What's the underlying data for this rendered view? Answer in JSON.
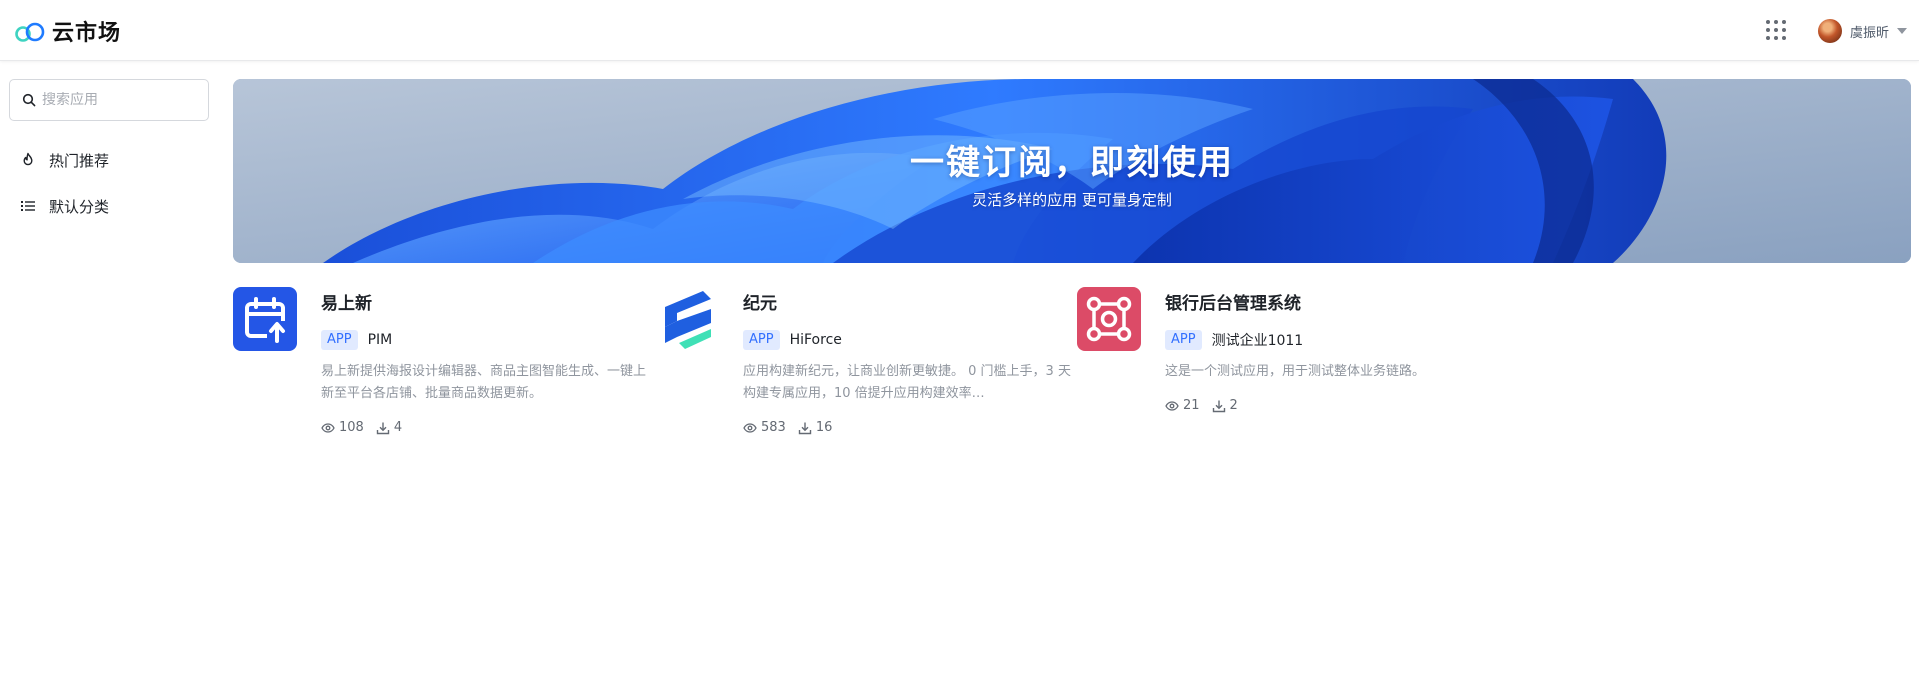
{
  "app": {
    "logo_text": "云市场",
    "logo_icon": "cloud-logo-icon"
  },
  "header": {
    "apps_icon": "grid-icon",
    "user_name": "虞振昕",
    "dropdown_icon": "chevron-down-icon"
  },
  "sidebar": {
    "search": {
      "placeholder": "搜索应用",
      "value": ""
    },
    "items": [
      {
        "label": "热门推荐",
        "icon": "flame-icon"
      },
      {
        "label": "默认分类",
        "icon": "list-icon"
      }
    ]
  },
  "banner": {
    "title": "一键订阅，即刻使用",
    "subtitle": "灵活多样的应用 更可量身定制"
  },
  "apps": [
    {
      "title": "易上新",
      "tag": "APP",
      "vendor": "PIM",
      "description": "易上新提供海报设计编辑器、商品主图智能生成、一键上新至平台各店铺、批量商品数据更新。",
      "views": "108",
      "downloads": "4",
      "icon": "calendar-upload-icon",
      "icon_color": "#2456e6"
    },
    {
      "title": "纪元",
      "tag": "APP",
      "vendor": "HiForce",
      "description": "应用构建新纪元，让商业创新更敏捷。 0 门槛上手，3 天构建专属应用，10 倍提升应用构建效率…",
      "views": "583",
      "downloads": "16",
      "icon": "hiforce-logo-icon",
      "icon_color": "#1f5fe0"
    },
    {
      "title": "银行后台管理系统",
      "tag": "APP",
      "vendor": "测试企业1011",
      "description": "这是一个测试应用，用于测试整体业务链路。",
      "views": "21",
      "downloads": "2",
      "icon": "nodes-square-icon",
      "icon_color": "#dc4b67"
    }
  ],
  "colors": {
    "accent": "#3370ff",
    "tag_bg": "#e1eaff",
    "muted_text": "#8f959e"
  }
}
